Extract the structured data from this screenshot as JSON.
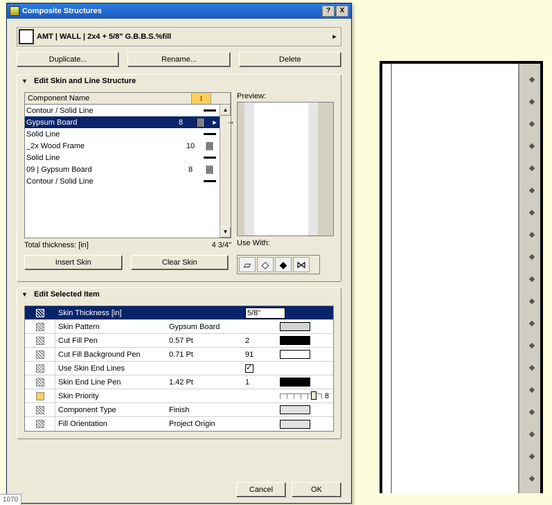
{
  "titlebar": {
    "title": "Composite Structures",
    "help": "?",
    "close": "X"
  },
  "selector": {
    "label": "AMT | WALL | 2x4 + 5/8\" G.B.B.S.%fill",
    "arrow": "▸"
  },
  "actions": {
    "duplicate": "Duplicate...",
    "rename": "Rename...",
    "delete": "Delete"
  },
  "section1": {
    "title": "Edit Skin and Line Structure"
  },
  "table": {
    "head": {
      "name": "Component Name",
      "priority_icon": "↕"
    },
    "rows": [
      {
        "name": "Contour / Solid Line",
        "pri": "",
        "line": 1
      },
      {
        "name": "Gypsum Board",
        "pri": "8",
        "hatch": 1,
        "sel": 1,
        "more": "▸"
      },
      {
        "name": "Solid Line",
        "pri": "",
        "line": 1
      },
      {
        "name": "_2x Wood Frame",
        "pri": "10",
        "hatch": 1
      },
      {
        "name": "Solid Line",
        "pri": "",
        "line": 1
      },
      {
        "name": "09 | Gypsum Board",
        "pri": "8",
        "hatch": 1
      },
      {
        "name": "Contour / Solid Line",
        "pri": "",
        "line": 1
      }
    ]
  },
  "total": {
    "label": "Total thickness: [in]",
    "value": "4 3/4\""
  },
  "preview": {
    "label": "Preview:"
  },
  "usewith": {
    "label": "Use With:"
  },
  "skinbtns": {
    "insert": "Insert Skin",
    "clear": "Clear Skin"
  },
  "section2": {
    "title": "Edit Selected Item"
  },
  "props": {
    "thickness": {
      "label": "Skin Thickness [in]",
      "value": "5/8\""
    },
    "pattern": {
      "label": "Skin Pattern",
      "value": "Gypsum Board"
    },
    "cutfill": {
      "label": "Cut Fill Pen",
      "v1": "0.57 Pt",
      "v2": "2"
    },
    "cutbg": {
      "label": "Cut Fill Background Pen",
      "v1": "0.71 Pt",
      "v2": "91"
    },
    "endlines": {
      "label": "Use Skin End Lines"
    },
    "endpen": {
      "label": "Skin End Line Pen",
      "v1": "1.42 Pt",
      "v2": "1"
    },
    "priority": {
      "label": "Skin Priority",
      "value": "8"
    },
    "comptype": {
      "label": "Component Type",
      "value": "Finish"
    },
    "fillori": {
      "label": "Fill Orientation",
      "value": "Project Origin"
    }
  },
  "footer": {
    "cancel": "Cancel",
    "ok": "OK"
  },
  "status": {
    "corner": "1070"
  }
}
